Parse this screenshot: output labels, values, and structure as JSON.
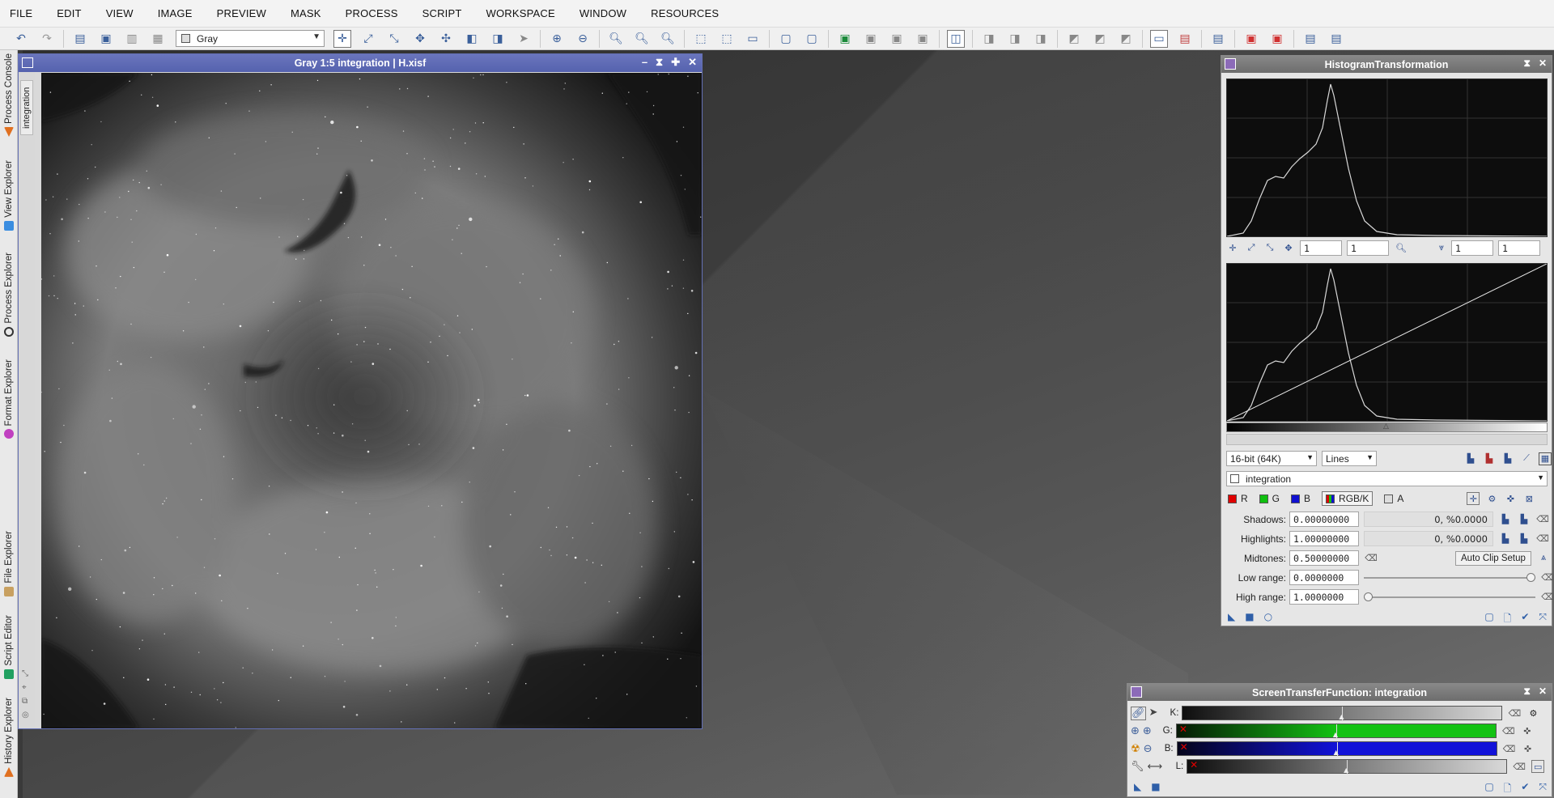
{
  "menubar": {
    "items": [
      "FILE",
      "EDIT",
      "VIEW",
      "IMAGE",
      "PREVIEW",
      "MASK",
      "PROCESS",
      "SCRIPT",
      "WORKSPACE",
      "WINDOW",
      "RESOURCES"
    ]
  },
  "toolbar": {
    "color_mode": "Gray"
  },
  "left_dock": {
    "tabs": [
      {
        "label": "Process Console",
        "icon": "console-icon",
        "color": "#e07020"
      },
      {
        "label": "View Explorer",
        "icon": "view-explorer-icon",
        "color": "#3a8de0"
      },
      {
        "label": "Process Explorer",
        "icon": "gear-icon",
        "color": "#333333"
      },
      {
        "label": "Format Explorer",
        "icon": "format-explorer-icon",
        "color": "#c040c0"
      },
      {
        "label": "File Explorer",
        "icon": "file-explorer-icon",
        "color": "#c8a060"
      },
      {
        "label": "Script Editor",
        "icon": "script-editor-icon",
        "color": "#20a060"
      },
      {
        "label": "History Explorer",
        "icon": "history-icon",
        "color": "#e07020"
      }
    ]
  },
  "image_window": {
    "title": "Gray 1:5 integration | H.xisf",
    "side_tab": "integration",
    "accent": "#5562ae"
  },
  "histogram": {
    "title": "HistogramTransformation",
    "zoom_h": "1",
    "zoom_v": "1",
    "zoom_h2": "1",
    "zoom_v2": "1",
    "resolution": "16-bit (64K)",
    "graph_style": "Lines",
    "view": "integration",
    "channels": {
      "r": "R",
      "g": "G",
      "b": "B",
      "rgbk": "RGB/K",
      "a": "A"
    },
    "shadows_label": "Shadows:",
    "shadows_value": "0.00000000",
    "shadows_info": "0, %0.0000",
    "highlights_label": "Highlights:",
    "highlights_value": "1.00000000",
    "highlights_info": "0, %0.0000",
    "midtones_label": "Midtones:",
    "midtones_value": "0.50000000",
    "auto_clip_label": "Auto Clip Setup",
    "low_range_label": "Low range:",
    "low_range_value": "0.0000000",
    "high_range_label": "High range:",
    "high_range_value": "1.0000000",
    "low_range_slider": 1.0,
    "high_range_slider": 0.0
  },
  "stf": {
    "title": "ScreenTransferFunction: integration",
    "rows": [
      {
        "label": "K:",
        "color": "#9a9a9a",
        "dark": "#111111"
      },
      {
        "label": "G:",
        "color": "#13c213",
        "dark": "#061806"
      },
      {
        "label": "B:",
        "color": "#1212d8",
        "dark": "#04041a"
      },
      {
        "label": "L:",
        "color": "#9a9a9a",
        "dark": "#111111"
      }
    ],
    "midtone_fraction": 0.5
  }
}
